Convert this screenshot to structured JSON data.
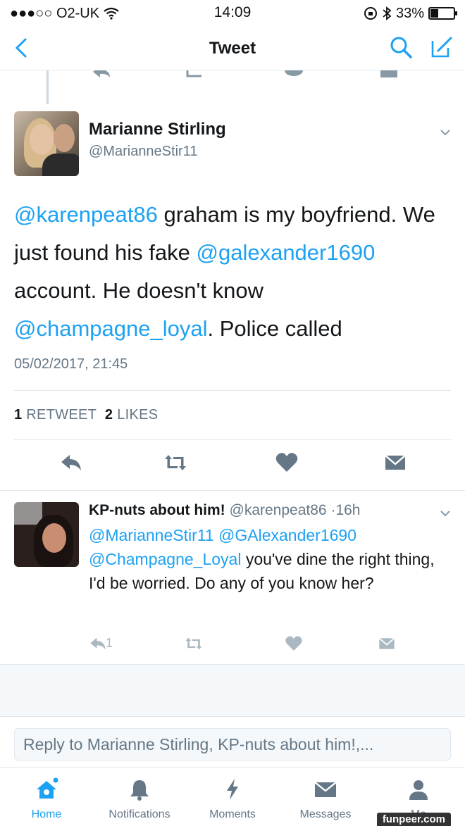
{
  "status_bar": {
    "carrier": "●●●○○ O2-UK",
    "time": "14:09",
    "battery": "33%",
    "battery_level": 0.33
  },
  "nav": {
    "title": "Tweet"
  },
  "main_tweet": {
    "name": "Marianne Stirling",
    "handle": "@MarianneStir11",
    "text_parts": [
      {
        "text": "@karenpeat86",
        "link": true
      },
      {
        "text": " graham is my boyfriend. We just found his fake ",
        "link": false
      },
      {
        "text": "@galexander1690",
        "link": true
      },
      {
        "text": " account. He doesn't know ",
        "link": false
      },
      {
        "text": "@champagne_loyal",
        "link": true
      },
      {
        "text": ". Police called",
        "link": false
      }
    ],
    "timestamp": "05/02/2017, 21:45",
    "retweets_count": "1",
    "retweets_label": "RETWEET",
    "likes_count": "2",
    "likes_label": "LIKES"
  },
  "reply_tweet": {
    "name": "KP-nuts about him!",
    "handle": "@karenpeat86",
    "time": "16h",
    "text_parts": [
      {
        "text": "@MarianneStir11",
        "link": true
      },
      {
        "text": " ",
        "link": false
      },
      {
        "text": "@GAlexander1690",
        "link": true
      },
      {
        "text": " ",
        "link": false
      },
      {
        "text": "@Champagne_Loyal",
        "link": true
      },
      {
        "text": " you've dine the right thing, I'd be worried. Do any of you know her?",
        "link": false
      }
    ],
    "reply_count": "1"
  },
  "composer": {
    "placeholder": "Reply to Marianne Stirling, KP-nuts about him!,..."
  },
  "tabs": [
    {
      "label": "Home",
      "icon": "home-icon",
      "active": true
    },
    {
      "label": "Notifications",
      "icon": "bell-icon",
      "active": false
    },
    {
      "label": "Moments",
      "icon": "lightning-icon",
      "active": false
    },
    {
      "label": "Messages",
      "icon": "envelope-icon",
      "active": false
    },
    {
      "label": "Me",
      "icon": "person-icon",
      "active": false
    }
  ],
  "watermark": "funpeer.com",
  "colors": {
    "link": "#1da1f2",
    "icon_gray": "#657786",
    "icon_light": "#aab8c2"
  }
}
